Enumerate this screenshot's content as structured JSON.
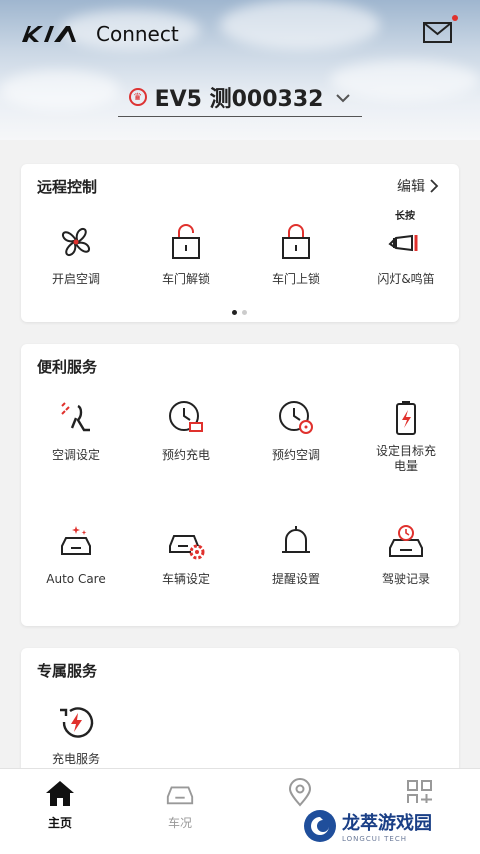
{
  "header": {
    "brand": "Connect",
    "vehicle": "EV5 测000332",
    "colors": {
      "accent": "#e0312d"
    }
  },
  "remote": {
    "title": "远程控制",
    "edit_label": "编辑",
    "long_press_hint": "长按",
    "items": [
      {
        "label": "开启空调",
        "icon": "fan-icon"
      },
      {
        "label": "车门解锁",
        "icon": "unlock-icon"
      },
      {
        "label": "车门上锁",
        "icon": "lock-icon"
      },
      {
        "label": "闪灯&鸣笛",
        "icon": "horn-icon"
      }
    ],
    "page": 1,
    "pages": 2
  },
  "convenience": {
    "title": "便利服务",
    "items": [
      {
        "label": "空调设定",
        "icon": "climate-seat-icon"
      },
      {
        "label": "预约充电",
        "icon": "schedule-charge-icon"
      },
      {
        "label": "预约空调",
        "icon": "schedule-climate-icon"
      },
      {
        "label": "设定目标充电量",
        "icon": "battery-target-icon"
      },
      {
        "label": "Auto Care",
        "icon": "auto-care-icon"
      },
      {
        "label": "车辆设定",
        "icon": "car-settings-icon"
      },
      {
        "label": "提醒设置",
        "icon": "bell-icon"
      },
      {
        "label": "驾驶记录",
        "icon": "drive-record-icon"
      }
    ]
  },
  "exclusive": {
    "title": "专属服务",
    "items": [
      {
        "label": "充电服务",
        "icon": "charging-service-icon"
      }
    ]
  },
  "tabbar": {
    "tabs": [
      {
        "label": "主页",
        "icon": "home-icon",
        "active": true
      },
      {
        "label": "车况",
        "icon": "car-status-icon",
        "active": false
      },
      {
        "label": "",
        "icon": "location-icon",
        "active": false
      },
      {
        "label": "",
        "icon": "grid-plus-icon",
        "active": false
      }
    ]
  },
  "watermark": {
    "cn": "龙萃游戏园",
    "en": "LONGCUI TECH"
  }
}
